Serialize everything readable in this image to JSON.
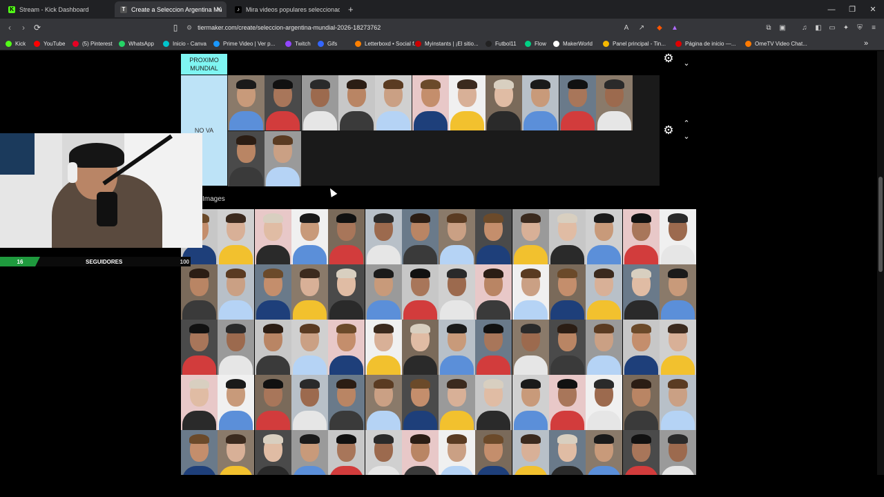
{
  "browser": {
    "tabs": [
      {
        "label": "Stream - Kick Dashboard",
        "icon": "kick-icon",
        "color": "#53fc18"
      },
      {
        "label": "Create a Seleccion Argentina Mu",
        "icon": "tiermaker-icon",
        "color": "#888888"
      },
      {
        "label": "Mira videos populares seleccionados",
        "icon": "tiktok-icon",
        "color": "#ffffff"
      }
    ],
    "new_tab": "+",
    "url": "tiermaker.com/create/seleccion-argentina-mundial-2026-18273762",
    "bookmarks": [
      {
        "label": "Kick",
        "color": "#53fc18"
      },
      {
        "label": "YouTube",
        "color": "#ff0000"
      },
      {
        "label": "(5) Pinterest",
        "color": "#e60023"
      },
      {
        "label": "WhatsApp",
        "color": "#25d366"
      },
      {
        "label": "Inicio - Canva",
        "color": "#00c4cc"
      },
      {
        "label": "Prime Video | Ver p...",
        "color": "#1a98ff"
      },
      {
        "label": "Twitch",
        "color": "#9146ff"
      },
      {
        "label": "Gifs",
        "color": "#3366ff"
      },
      {
        "label": "Letterboxd • Social f...",
        "color": "#ff8000"
      },
      {
        "label": "Myinstants | ¡El sitio...",
        "color": "#cc0000"
      },
      {
        "label": "Futbol11",
        "color": "#222222"
      },
      {
        "label": "Flow",
        "color": "#00d084"
      },
      {
        "label": "MakerWorld",
        "color": "#ffffff"
      },
      {
        "label": "Panel principal - Tin...",
        "color": "#f5b800"
      },
      {
        "label": "Página de inicio —...",
        "color": "#e00000"
      },
      {
        "label": "OmeTV Video Chat...",
        "color": "#ff7a00"
      }
    ],
    "bookmarks_more": "»"
  },
  "tierlist": {
    "tiers": [
      {
        "label": "PROXIMO MUNDIAL",
        "color": "#7ff5f2"
      },
      {
        "label": "NO VA",
        "color": "#bde3f7"
      }
    ],
    "images_label": "Images",
    "settings_icon": "gear-icon",
    "up_icon": "chevron-up-icon",
    "down_icon": "chevron-down-icon"
  },
  "webcam": {
    "followers_count": "16",
    "followers_label": "SEGUIDORES",
    "followers_goal": "100"
  }
}
